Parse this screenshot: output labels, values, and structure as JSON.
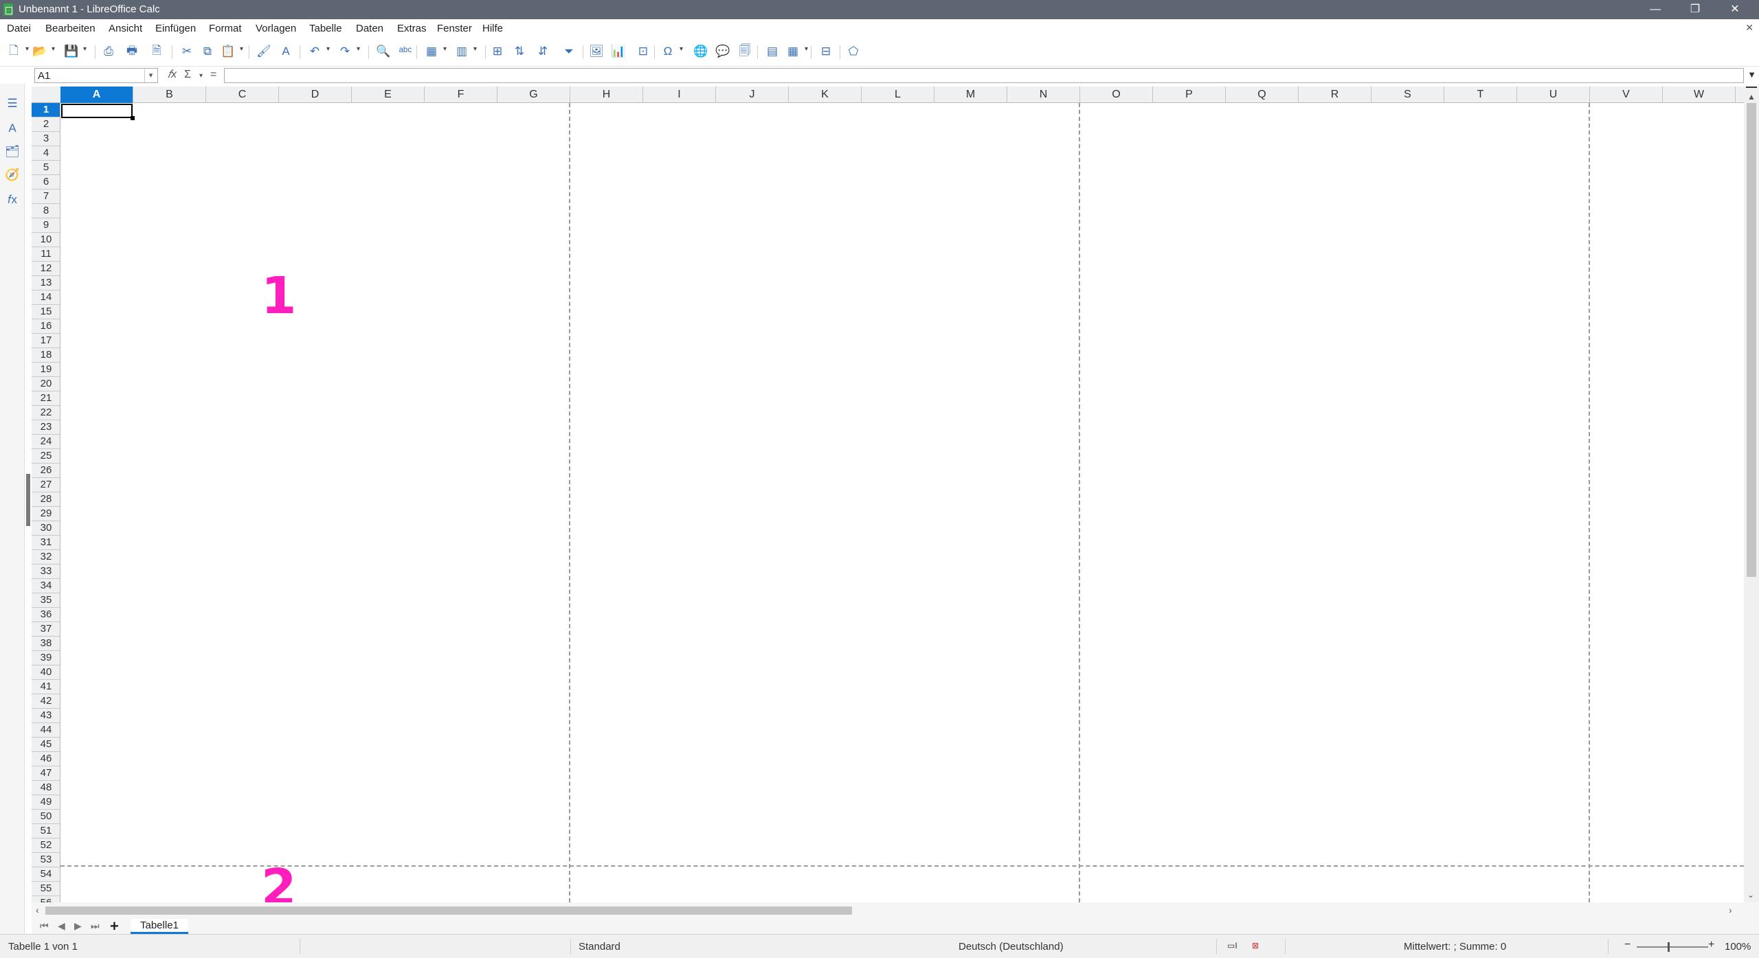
{
  "window": {
    "title": "Unbenannt 1 - LibreOffice Calc",
    "min_glyph": "—",
    "max_glyph": "❐",
    "close_glyph": "✕",
    "doc_close_glyph": "✕"
  },
  "menu": [
    {
      "label": "Datei"
    },
    {
      "label": "Bearbeiten"
    },
    {
      "label": "Ansicht"
    },
    {
      "label": "Einfügen"
    },
    {
      "label": "Format"
    },
    {
      "label": "Vorlagen"
    },
    {
      "label": "Tabelle"
    },
    {
      "label": "Daten"
    },
    {
      "label": "Extras"
    },
    {
      "label": "Fenster"
    },
    {
      "label": "Hilfe"
    }
  ],
  "toolbar": [
    {
      "name": "new-document-icon",
      "glyph": "🗋",
      "dropdown": true
    },
    {
      "name": "open-folder-icon",
      "glyph": "📂",
      "dropdown": true
    },
    {
      "name": "save-icon",
      "glyph": "💾",
      "dropdown": true
    },
    {
      "name": "export-pdf-icon",
      "glyph": "⎙"
    },
    {
      "name": "print-icon",
      "glyph": "🖶"
    },
    {
      "name": "print-preview-icon",
      "glyph": "🗎"
    },
    {
      "name": "cut-icon",
      "glyph": "✂"
    },
    {
      "name": "copy-icon",
      "glyph": "⧉"
    },
    {
      "name": "paste-icon",
      "glyph": "📋",
      "dropdown": true
    },
    {
      "name": "clone-formatting-icon",
      "glyph": "🖌"
    },
    {
      "name": "clear-formatting-icon",
      "glyph": "A"
    },
    {
      "name": "undo-icon",
      "glyph": "↶",
      "dropdown": true
    },
    {
      "name": "redo-icon",
      "glyph": "↷",
      "dropdown": true
    },
    {
      "name": "find-replace-icon",
      "glyph": "🔍"
    },
    {
      "name": "spellcheck-icon",
      "glyph": "ᵃᵇᶜ"
    },
    {
      "name": "row-icon",
      "glyph": "▦",
      "dropdown": true
    },
    {
      "name": "column-icon",
      "glyph": "▥",
      "dropdown": true
    },
    {
      "name": "toggle-column-icon",
      "glyph": "⊞"
    },
    {
      "name": "sort-ascending-icon",
      "glyph": "⇅"
    },
    {
      "name": "sort-descending-icon",
      "glyph": "⇵"
    },
    {
      "name": "autofilter-icon",
      "glyph": "⏷"
    },
    {
      "name": "insert-image-icon",
      "glyph": "🖼"
    },
    {
      "name": "insert-chart-icon",
      "glyph": "📊"
    },
    {
      "name": "pivot-table-icon",
      "glyph": "⊡"
    },
    {
      "name": "special-character-icon",
      "glyph": "Ω",
      "dropdown": true
    },
    {
      "name": "hyperlink-icon",
      "glyph": "🌐"
    },
    {
      "name": "comment-icon",
      "glyph": "💬"
    },
    {
      "name": "headers-footers-icon",
      "glyph": "🗐"
    },
    {
      "name": "define-print-area-icon",
      "glyph": "▤"
    },
    {
      "name": "freeze-rows-columns-icon",
      "glyph": "▦",
      "dropdown": true
    },
    {
      "name": "split-window-icon",
      "glyph": "⊟"
    },
    {
      "name": "show-draw-functions-icon",
      "glyph": "⬠"
    }
  ],
  "formula": {
    "name_box": "A1",
    "fx_glyph": "𝑓x",
    "sum_glyph": "Σ",
    "equals_glyph": "=",
    "content": ""
  },
  "sidebar": [
    {
      "name": "properties-icon",
      "glyph": "☰"
    },
    {
      "name": "styles-icon",
      "glyph": "A"
    },
    {
      "name": "gallery-icon",
      "glyph": "🗂"
    },
    {
      "name": "navigator-icon",
      "glyph": "🧭"
    },
    {
      "name": "functions-icon",
      "glyph": "𝑓x"
    }
  ],
  "columns": [
    "A",
    "B",
    "C",
    "D",
    "E",
    "F",
    "G",
    "H",
    "I",
    "J",
    "K",
    "L",
    "M",
    "N",
    "O",
    "P",
    "Q",
    "R",
    "S",
    "T",
    "U",
    "V",
    "W"
  ],
  "active_column": "A",
  "rows_visible": 56,
  "active_row": 1,
  "page_numbers": [
    "1",
    "2"
  ],
  "sheets": [
    {
      "label": "Tabelle1",
      "active": true
    }
  ],
  "status": {
    "sheet_info": "Tabelle 1 von 1",
    "page_style": "Standard",
    "language": "Deutsch (Deutschland)",
    "selection_summary": "Mittelwert: ; Summe: 0",
    "zoom": "100%"
  }
}
